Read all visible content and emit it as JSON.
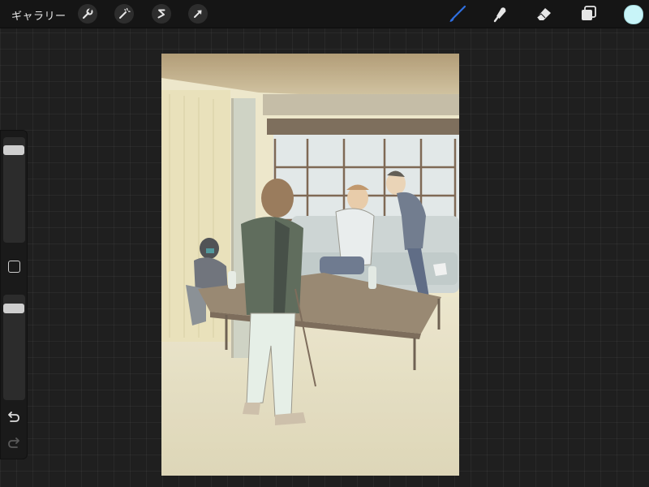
{
  "toolbar": {
    "gallery_label": "ギャラリー",
    "left_tools": [
      {
        "name": "actions",
        "icon": "wrench-icon"
      },
      {
        "name": "adjustments",
        "icon": "magic-wand-icon"
      },
      {
        "name": "selection",
        "icon": "selection-s-icon"
      },
      {
        "name": "transform",
        "icon": "arrow-cursor-icon"
      }
    ],
    "right_tools": [
      {
        "name": "brush",
        "icon": "brush-icon",
        "active": true
      },
      {
        "name": "smudge",
        "icon": "smudge-icon"
      },
      {
        "name": "eraser",
        "icon": "eraser-icon"
      },
      {
        "name": "layers",
        "icon": "layers-icon"
      }
    ],
    "active_color": "#c8f4f8",
    "active_tool_color": "#2f6fe0"
  },
  "sidebar": {
    "brush_size_level": 0.9,
    "opacity_level": 0.9
  }
}
